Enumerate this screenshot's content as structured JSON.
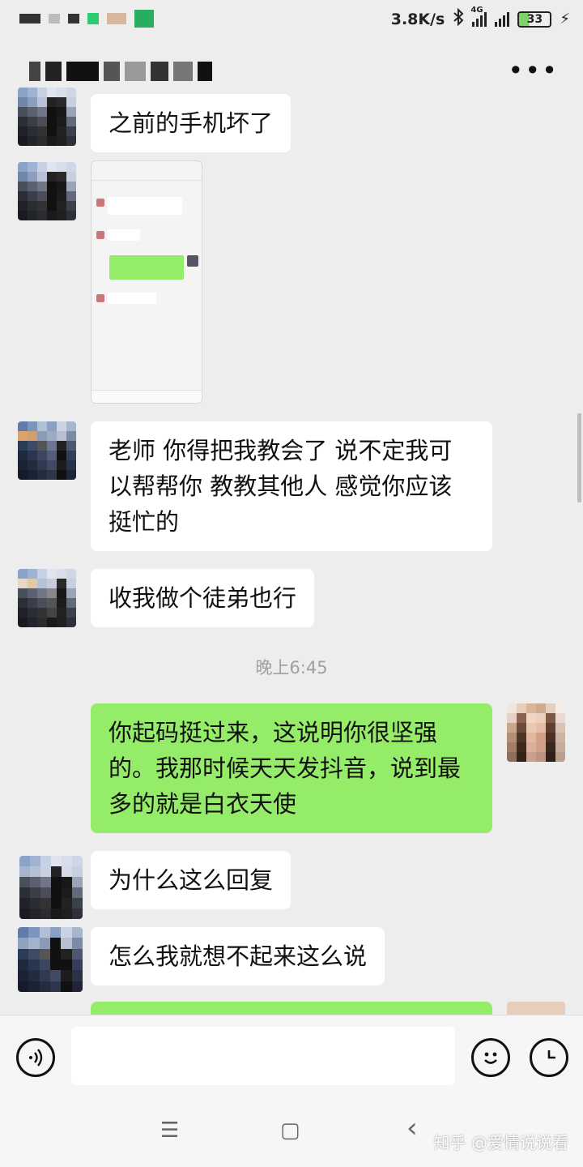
{
  "status_bar": {
    "network_speed": "3.8K/s",
    "signal_label": "4G",
    "battery": "33",
    "icons": [
      "bluetooth-icon",
      "signal-icon",
      "battery-icon",
      "charging-icon"
    ]
  },
  "header": {
    "more_label": "•••"
  },
  "messages": [
    {
      "side": "left",
      "text": "之前的手机坏了"
    },
    {
      "side": "left",
      "type": "image"
    },
    {
      "side": "left",
      "text": "老师 你得把我教会了 说不定我可以帮帮你 教教其他人 感觉你应该挺忙的"
    },
    {
      "side": "left",
      "text": "收我做个徒弟也行"
    },
    {
      "side": "right",
      "text": "你起码挺过来，这说明你很坚强的。我那时候天天发抖音，说到最多的就是白衣天使"
    },
    {
      "side": "left",
      "text": "为什么这么回复"
    },
    {
      "side": "left",
      "text": "怎么我就想不起来这么说"
    }
  ],
  "time_divider": "晚上6:45",
  "input": {
    "value": ""
  },
  "nav": {
    "menu": "☰",
    "home": "▢",
    "back": "‹"
  },
  "watermark": "知乎 @爱情说说看",
  "colors": {
    "background": "#ededed",
    "sent_bubble": "#95ec69",
    "received_bubble": "#ffffff",
    "timestamp": "#a0a0a0"
  }
}
